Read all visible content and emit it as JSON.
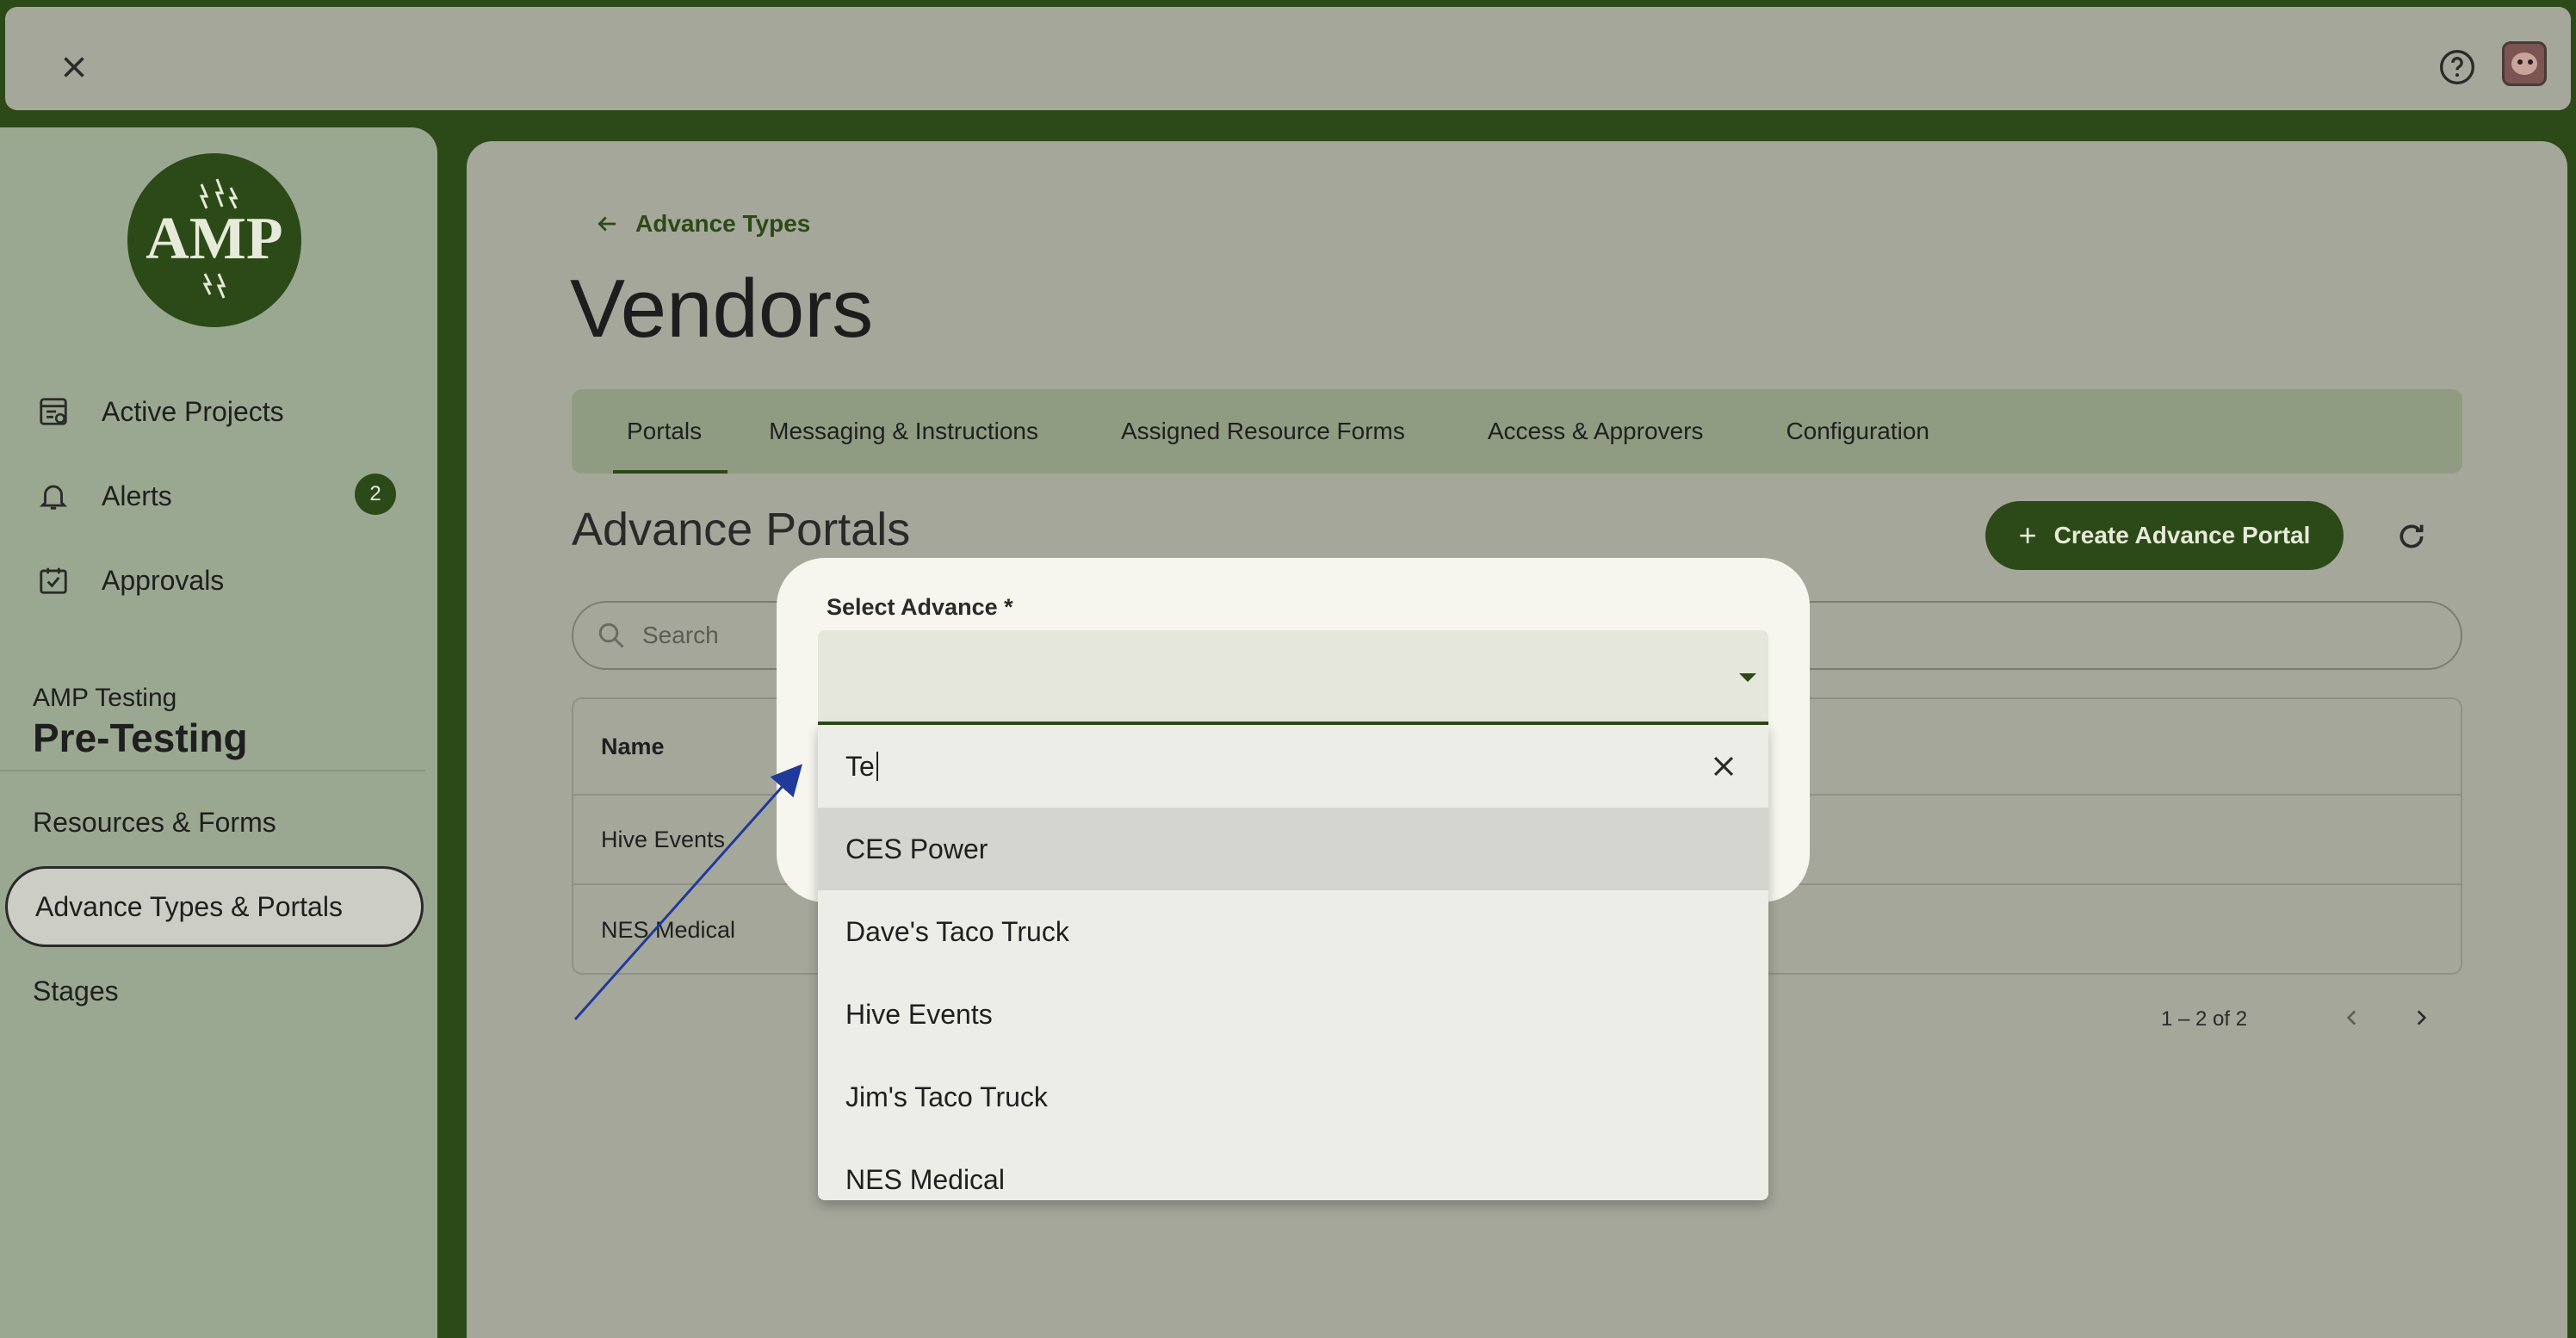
{
  "topbar": {
    "close_icon": "close-icon",
    "help_icon": "help-icon",
    "avatar": "avatar"
  },
  "sidebar": {
    "logo_text": "AMP",
    "nav": [
      {
        "label": "Active Projects",
        "icon": "projects-icon"
      },
      {
        "label": "Alerts",
        "icon": "bell-icon",
        "badge": "2"
      },
      {
        "label": "Approvals",
        "icon": "calendar-check-icon"
      }
    ],
    "project_label": "AMP Testing",
    "project_name": "Pre-Testing",
    "sub_items": [
      "Resources & Forms",
      "Advance Types & Portals",
      "Stages"
    ]
  },
  "main": {
    "breadcrumb": "Advance Types",
    "title": "Vendors",
    "tabs": [
      "Portals",
      "Messaging & Instructions",
      "Assigned Resource Forms",
      "Access & Approvers",
      "Configuration"
    ],
    "section_title": "Advance Portals",
    "create_button": "Create Advance Portal",
    "search_placeholder": "Search",
    "table": {
      "header": "Name",
      "rows": [
        "Hive Events",
        "NES Medical"
      ]
    },
    "pager": "1 – 2 of 2"
  },
  "dialog": {
    "label": "Select Advance *",
    "search_value": "Te",
    "options": [
      "CES Power",
      "Dave's Taco Truck",
      "Hive Events",
      "Jim's Taco Truck",
      "NES Medical"
    ]
  },
  "colors": {
    "brand": "#2c4a17",
    "sidebar_bg": "#9ba891",
    "main_bg": "#a5a79b",
    "dialog_bg": "#f6f6ee",
    "annotation_arrow": "#1f3a9a"
  }
}
